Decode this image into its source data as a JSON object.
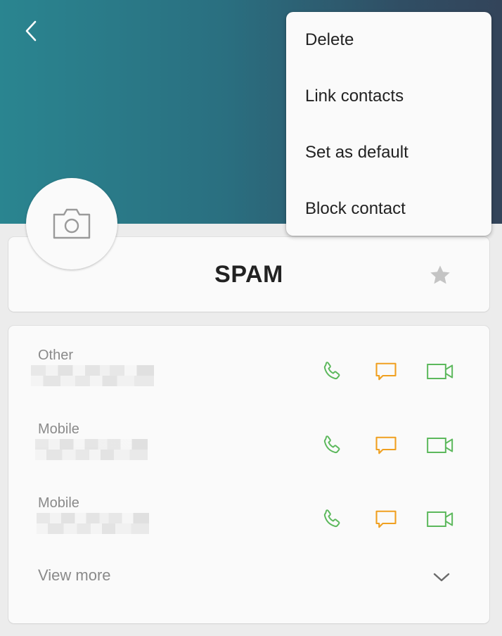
{
  "header": {
    "back_icon": "chevron-left-icon",
    "gradient": [
      "#2a8590",
      "#33445a"
    ]
  },
  "avatar": {
    "icon": "camera-icon"
  },
  "contact": {
    "name": "SPAM",
    "favorite_icon": "star-icon"
  },
  "numbers": [
    {
      "label": "Other"
    },
    {
      "label": "Mobile"
    },
    {
      "label": "Mobile"
    }
  ],
  "actions": {
    "call_icon": "phone-icon",
    "message_icon": "message-icon",
    "video_icon": "video-call-icon",
    "call_color": "#5cb85c",
    "message_color": "#f0a020",
    "video_color": "#5cb85c"
  },
  "view_more": {
    "label": "View more",
    "icon": "chevron-down-icon"
  },
  "menu": {
    "items": [
      "Delete",
      "Link contacts",
      "Set as default",
      "Block contact"
    ]
  }
}
